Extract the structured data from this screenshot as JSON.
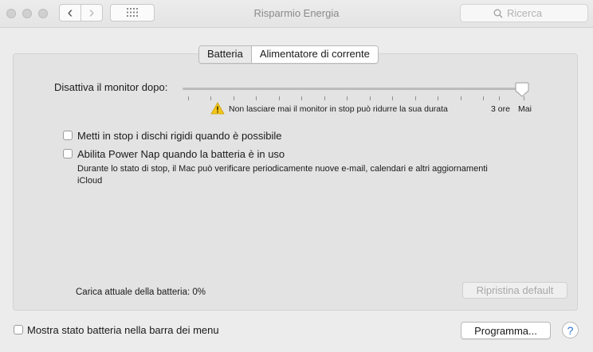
{
  "window": {
    "title": "Risparmio Energia",
    "search_placeholder": "Ricerca",
    "back_glyph": "‹",
    "forward_glyph": "›",
    "grid_glyph": "⋮⋮⋮"
  },
  "tabs": [
    {
      "label": "Batteria",
      "selected": true
    },
    {
      "label": "Alimentatore di corrente",
      "selected": false
    }
  ],
  "monitor": {
    "label": "Disattiva il monitor dopo:",
    "slider_value": "Mai",
    "slider_fraction": 1.0,
    "warning": "Non lasciare mai il monitor in stop può ridurre la sua durata",
    "label_3h": "3 ore",
    "label_never": "Mai"
  },
  "options": {
    "disks_label": "Metti in stop i dischi rigidi quando è possibile",
    "disks_checked": false,
    "powernap_label": "Abilita Power Nap quando la batteria è in uso",
    "powernap_checked": false,
    "powernap_desc": "Durante lo stato di stop, il Mac può verificare periodicamente nuove e-mail, calendari e altri aggiornamenti iCloud"
  },
  "battery_status": "Carica attuale della batteria: 0%",
  "restore_default": "Ripristina default",
  "footer": {
    "show_status_label": "Mostra stato batteria nella barra dei menu",
    "show_status_checked": false,
    "schedule_button": "Programma...",
    "help_glyph": "?"
  },
  "colors": {
    "window_bg": "#ececec",
    "panel_bg": "#e3e3e3",
    "warning_yellow": "#f5c518",
    "help_blue": "#2a6ed0"
  },
  "icons": [
    "close-button",
    "minimize-button",
    "zoom-button",
    "back-icon",
    "forward-icon",
    "grid-icon",
    "search-icon",
    "warning-icon",
    "help-icon"
  ]
}
